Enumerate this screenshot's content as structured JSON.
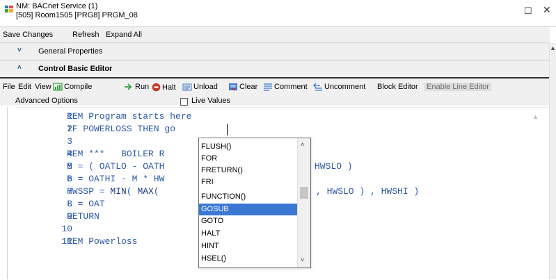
{
  "window": {
    "title_line1": "NM: BACnet Service (1)",
    "title_line2": "[505] Room1505 [PRG8] PRGM_08",
    "maximize_glyph": "☐",
    "close_glyph": "✕"
  },
  "menu": [
    "Save Changes",
    "Refresh",
    "Expand All"
  ],
  "sections": {
    "general": {
      "chevron": "˅",
      "label": "General Properties"
    },
    "control_basic": {
      "chevron": "˄",
      "label": "Control Basic Editor"
    }
  },
  "toolbar": {
    "file": "File",
    "edit": "Edit",
    "view": "View",
    "compile": "Compile",
    "run": "Run",
    "halt": "Halt",
    "unload": "Unload",
    "clear": "Clear",
    "comment": "Comment",
    "uncomment": "Uncomment",
    "block_editor": "Block Editor",
    "enable_line_editor": "Enable Line Editor",
    "advanced_options": "Advanced Options",
    "live_values": "Live Values",
    "live_values_checked": false
  },
  "icons": {
    "compile": "compile-icon",
    "run": "run-icon",
    "halt": "halt-icon",
    "unload": "unload-icon",
    "clear": "clear-icon",
    "comment": "comment-icon",
    "uncomment": "uncomment-icon"
  },
  "colors": {
    "code_text": "#2b5aa8",
    "selection": "#3a78d4",
    "halt_red": "#c0392b",
    "run_green": "#2e9e3e"
  },
  "editor": {
    "lines": [
      {
        "num": "1",
        "text": "REM Program starts here"
      },
      {
        "num": "2",
        "text": "IF POWERLOSS THEN go"
      },
      {
        "num": "3",
        "text": ""
      },
      {
        "num": "4",
        "text": "REM ***   BOILER R"
      },
      {
        "num": "5",
        "text": "M = ( OATLO - OATH"
      },
      {
        "num": "6",
        "text": "B = OATHI - M * HW"
      },
      {
        "num": "7",
        "text": "HWSSP = MIN( MAX( "
      },
      {
        "num": "8",
        "text": "L = OAT"
      },
      {
        "num": "9",
        "text": "RETURN"
      },
      {
        "num": "10",
        "text": ""
      },
      {
        "num": "11",
        "text": "REM Powerloss"
      }
    ],
    "line5_tail": "HWSLO )",
    "line7_tail": ", HWSLO ) , HWSHI )"
  },
  "autocomplete": {
    "items": [
      "FLUSH()",
      "FOR",
      "FRETURN()",
      "FRI",
      "FUNCTION()",
      "GOSUB",
      "GOTO",
      "HALT",
      "HINT",
      "HSEL()"
    ],
    "selected": "GOSUB"
  }
}
